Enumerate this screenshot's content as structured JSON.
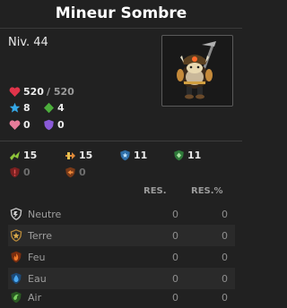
{
  "header": {
    "title": "Mineur Sombre"
  },
  "level": "Niv. 44",
  "portrait": {
    "icon": "dark-miner-portrait"
  },
  "vitals": {
    "hp": "520",
    "hp_max": "/ 520",
    "ap": "8",
    "mp": "4",
    "lock": "0",
    "shield": "0"
  },
  "res_fixed": {
    "dodge_ap": "15",
    "dodge_mp": "15",
    "res_ap": "11",
    "res_mp": "11",
    "crit_res": "0",
    "push_res": "0"
  },
  "table": {
    "col_res": "RES.",
    "col_res_pct": "RES.%",
    "rows": [
      {
        "name": "Neutre",
        "res": "0",
        "res_pct": "0",
        "icon": "neutral-element-icon",
        "color": "#cfcfcf"
      },
      {
        "name": "Terre",
        "res": "0",
        "res_pct": "0",
        "icon": "earth-element-icon",
        "color": "#b98a3a"
      },
      {
        "name": "Feu",
        "res": "0",
        "res_pct": "0",
        "icon": "fire-element-icon",
        "color": "#e0622a"
      },
      {
        "name": "Eau",
        "res": "0",
        "res_pct": "0",
        "icon": "water-element-icon",
        "color": "#3a8fd0"
      },
      {
        "name": "Air",
        "res": "0",
        "res_pct": "0",
        "icon": "air-element-icon",
        "color": "#5fb54a"
      }
    ]
  }
}
